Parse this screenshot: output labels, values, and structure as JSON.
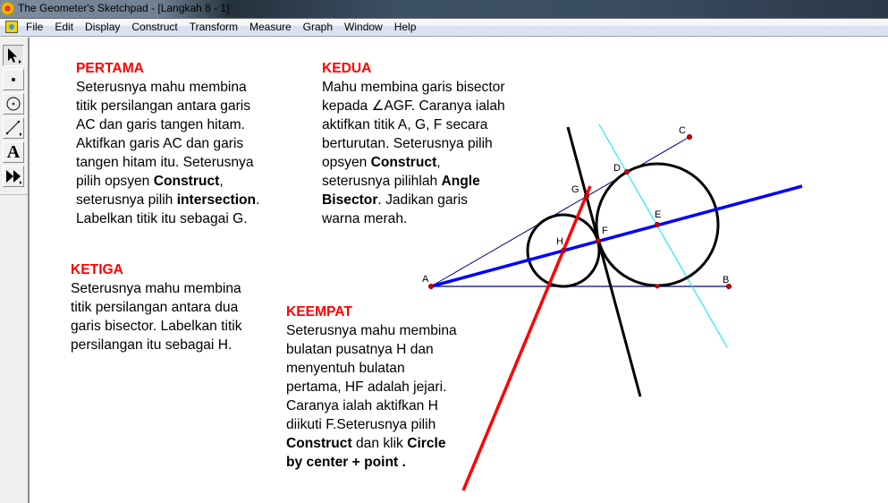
{
  "window": {
    "title": "The Geometer's Sketchpad - [Langkah 8 - 1]",
    "app_icon": "sketchpad-app-icon"
  },
  "menubar": {
    "doc_icon": "sketch-document-icon",
    "items": [
      "File",
      "Edit",
      "Display",
      "Construct",
      "Transform",
      "Measure",
      "Graph",
      "Window",
      "Help"
    ]
  },
  "toolbox": {
    "tools": [
      {
        "name": "selection-arrow-tool",
        "icon": "arrow-icon",
        "active": true
      },
      {
        "name": "point-tool",
        "icon": "point-icon"
      },
      {
        "name": "compass-tool",
        "icon": "circle-icon"
      },
      {
        "name": "straightedge-tool",
        "icon": "segment-icon"
      },
      {
        "name": "text-tool",
        "icon": "text-A-icon",
        "glyph": "A"
      },
      {
        "name": "custom-tool",
        "icon": "fast-forward-icon"
      }
    ]
  },
  "instructions": {
    "pertama": {
      "heading": "PERTAMA",
      "lines": [
        "Seterusnya mahu membina",
        "titik persilangan antara garis",
        "AC dan garis tangen hitam.",
        "Aktifkan garis AC dan garis",
        "tangen hitam itu. Seterusnya"
      ],
      "line6_pre": "pilih opsyen ",
      "line6_bold": "Construct",
      "line6_post": ",",
      "line7_pre": "seterusnya pilih ",
      "line7_bold": "intersection",
      "line7_post": ".",
      "line8": "Labelkan titik itu sebagai G."
    },
    "kedua": {
      "heading": "KEDUA",
      "line1": "Mahu membina garis bisector",
      "line2": "kepada ∠AGF. Caranya ialah",
      "line3": "aktifkan titik A, G, F secara",
      "line4": "berturutan. Seterusnya pilih",
      "line5_pre": "opsyen ",
      "line5_bold": "Construct",
      "line5_post": ",",
      "line6_pre": "seterusnya pilihlah ",
      "line6_bold": "Angle",
      "line7_bold": "Bisector",
      "line7_post": ". Jadikan garis",
      "line8": "warna merah."
    },
    "ketiga": {
      "heading": "KETIGA",
      "lines": [
        "Seterusnya mahu membina",
        "titik persilangan antara dua",
        "garis bisector. Labelkan titik",
        "persilangan itu sebagai H."
      ]
    },
    "keempat": {
      "heading": "KEEMPAT",
      "lines": [
        "Seterusnya mahu membina",
        "bulatan pusatnya H dan",
        "menyentuh bulatan",
        "pertama, HF adalah jejari.",
        "Caranya ialah aktifkan H",
        "diikuti F.Seterusnya pilih"
      ],
      "line7_bold1": "Construct",
      "line7_mid": " dan klik ",
      "line7_bold2": "Circle",
      "line8_bold": "by center + point ."
    }
  },
  "figure": {
    "point_labels": {
      "A": "A",
      "B": "B",
      "C": "C",
      "D": "D",
      "E": "E",
      "F": "F",
      "G": "G",
      "H": "H"
    },
    "colors": {
      "heading": "#ff0000",
      "bisector_blue": "#0000ff",
      "bisector_red": "#ff0000",
      "tangent_black": "#000000",
      "perpendicular_cyan": "#00e5ff",
      "ray_navy": "#000080",
      "point": "#cc0000"
    }
  }
}
